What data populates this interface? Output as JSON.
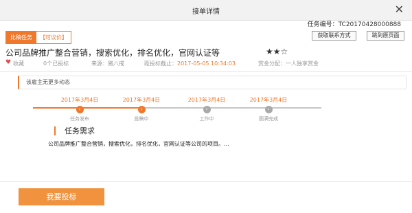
{
  "window": {
    "title": "接单详情",
    "close_glyph": "✕"
  },
  "task_no": "任务编号：TC20170428000888",
  "tags": {
    "type": "比稿任务",
    "price": "【可议价】"
  },
  "actions": {
    "contact": "获取联系方式",
    "origin": "跳到原页面"
  },
  "task": {
    "title": "公司品牌推广整合营销，搜索优化，排名优化，官网认证等",
    "stars": "★★☆"
  },
  "meta": {
    "favorite": "收藏",
    "bids": "0个已投标",
    "source": "来源：猪八戒",
    "deadline_label": "距投标截止：",
    "deadline_value": "2017-05-05 10:34:03",
    "reward": "赏金分配：一人独享赏金"
  },
  "notice": "该雇主无更多动态",
  "timeline": {
    "steps": [
      {
        "date": "2017年3月4日",
        "label": "任务发布",
        "status": "done"
      },
      {
        "date": "2017年3月4日",
        "label": "投稿中",
        "status": "done"
      },
      {
        "date": "2017年3月4日",
        "label": "工作中",
        "status": "todo"
      },
      {
        "date": "2017年3月4日",
        "label": "圆满完成",
        "status": "todo"
      }
    ]
  },
  "requirement": {
    "heading": "任务需求",
    "body": "公司品牌推广整合营销，搜索优化，排名优化，官网认证等公司的项目。..."
  },
  "submit": "我要投标",
  "colors": {
    "accent": "#f0782d",
    "button": "#f0923e",
    "inactive": "#a9a9a9"
  }
}
